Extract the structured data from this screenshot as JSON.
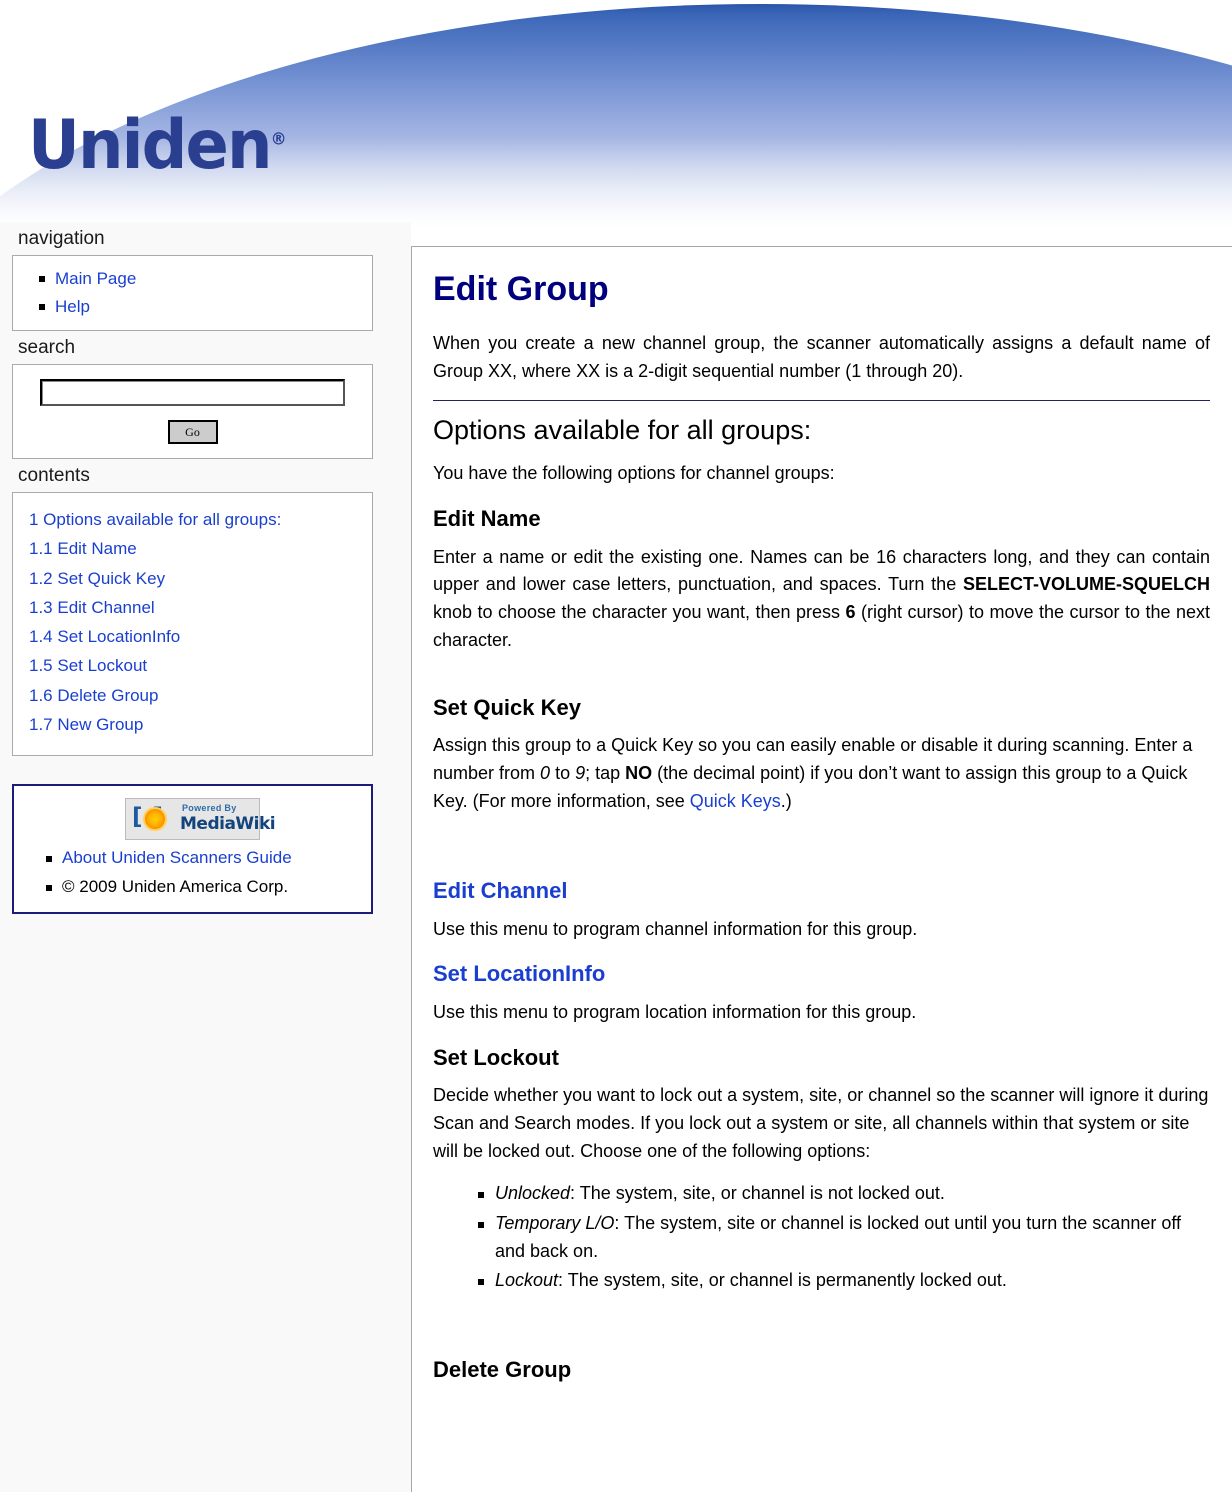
{
  "site": {
    "logo_text": "Uniden",
    "logo_reg": "®"
  },
  "sidebar": {
    "navigation": {
      "title": "navigation",
      "items": [
        {
          "label": "Main Page"
        },
        {
          "label": "Help"
        }
      ]
    },
    "search": {
      "title": "search",
      "value": "",
      "placeholder": "",
      "go_label": "Go"
    },
    "contents": {
      "title": "contents",
      "items": [
        {
          "label": "1 Options available for all groups:"
        },
        {
          "label": "1.1 Edit Name"
        },
        {
          "label": "1.2 Set Quick Key"
        },
        {
          "label": "1.3 Edit Channel"
        },
        {
          "label": "1.4 Set LocationInfo"
        },
        {
          "label": "1.5 Set Lockout"
        },
        {
          "label": "1.6 Delete Group"
        },
        {
          "label": "1.7 New Group"
        }
      ]
    },
    "footer": {
      "logo_brackets": "[ ]",
      "logo_powered": "Powered By",
      "logo_name": "MediaWiki",
      "items": [
        {
          "label": "About Uniden Scanners Guide"
        },
        {
          "label": "© 2009 Uniden America Corp."
        }
      ]
    }
  },
  "content": {
    "title": "Edit Group",
    "intro": "When you create a new channel group, the scanner automatically assigns a default name of Group XX, where XX is a 2-digit sequential number (1 through 20).",
    "section_options_title": "Options available for all groups:",
    "section_options_intro": "You have the following options for channel groups:",
    "edit_name": {
      "heading": "Edit Name",
      "text_a": "Enter a name or edit the existing one. Names can be 16 characters long, and they can contain upper and lower case letters, punctuation, and spaces. Turn the ",
      "knob": "SELECT-VOLUME-SQUELCH",
      "text_b": " knob to choose the character you want, then press ",
      "key": "6",
      "text_c": " (right cursor) to move the cursor to the next character."
    },
    "set_quick_key": {
      "heading": "Set Quick Key",
      "text_a": "Assign this group to a Quick Key so you can easily enable or disable it during scanning. Enter a number from ",
      "num_from": "0",
      "text_b": " to ",
      "num_to": "9",
      "text_c": "; tap ",
      "no_key": "NO",
      "text_d": " (the decimal point) if you don’t want to assign this group to a Quick Key. (For more information, see ",
      "link": "Quick Keys",
      "text_e": ".)"
    },
    "edit_channel": {
      "heading": "Edit Channel",
      "text": "Use this menu to program channel information for this group."
    },
    "set_locationinfo": {
      "heading": "Set LocationInfo",
      "text": "Use this menu to program location information for this group."
    },
    "set_lockout": {
      "heading": "Set Lockout",
      "text": "Decide whether you want to lock out a system, site, or channel so the scanner will ignore it during Scan and Search modes. If you lock out a system or site, all channels within that system or site will be locked out. Choose one of the following options:",
      "options": [
        {
          "term": "Unlocked",
          "desc": ": The system, site, or channel is not locked out."
        },
        {
          "term": "Temporary L/O",
          "desc": ": The system, site or channel is locked out until you turn the scanner off and back on."
        },
        {
          "term": "Lockout",
          "desc": ": The system, site, or channel is permanently locked out."
        }
      ]
    },
    "delete_group": {
      "heading": "Delete Group"
    }
  },
  "colors": {
    "link": "#1a3fd0",
    "title": "#00007f",
    "banner_blue": "#2a55a8",
    "logo_blue": "#2a3f90"
  }
}
